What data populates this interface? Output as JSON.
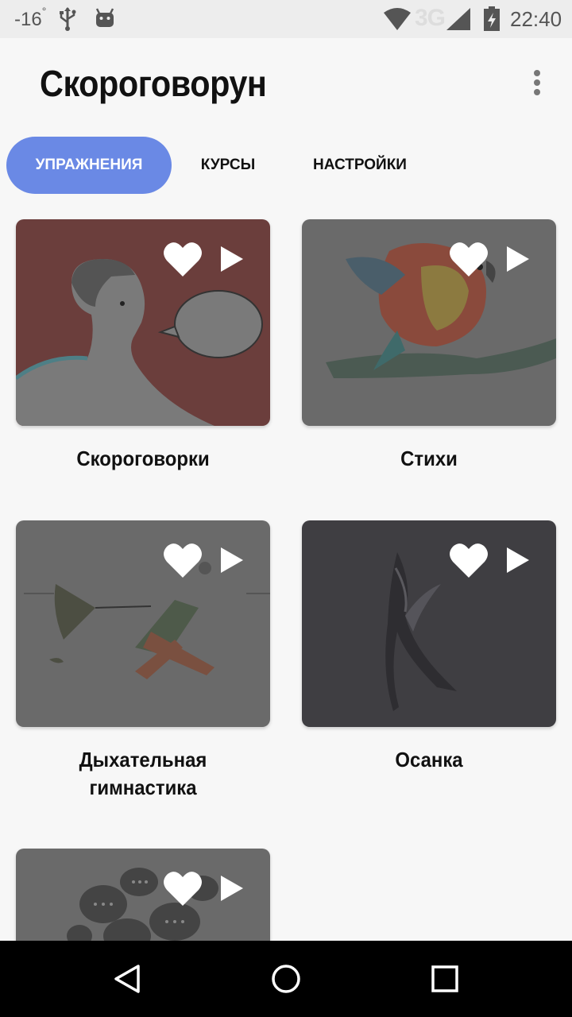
{
  "status_bar": {
    "temperature": "-16",
    "temperature_unit": "°",
    "network": "3G",
    "time": "22:40"
  },
  "app": {
    "title": "Скороговорун"
  },
  "tabs": [
    {
      "label": "УПРАЖНЕНИЯ",
      "active": true
    },
    {
      "label": "КУРСЫ",
      "active": false
    },
    {
      "label": "НАСТРОЙКИ",
      "active": false
    }
  ],
  "colors": {
    "accent": "#6a89e5",
    "card_1": "#6b3e3c",
    "card_2": "#6a6a6a",
    "card_3": "#6a6a6a",
    "card_4": "#3f3e42",
    "card_5": "#6a6a6a"
  },
  "cards": [
    {
      "label": "Скороговорки",
      "icon": "speaking-profile-illustration"
    },
    {
      "label": "Стихи",
      "icon": "parrot-illustration"
    },
    {
      "label_line1": "Дыхательная",
      "label_line2": "гимнастика",
      "icon": "umbrella-wind-illustration"
    },
    {
      "label": "Осанка",
      "icon": "dancer-illustration"
    },
    {
      "label": "",
      "icon": "speech-bubbles-illustration"
    }
  ],
  "card_actions": {
    "favorite_icon": "heart-icon",
    "play_icon": "play-icon"
  },
  "nav": {
    "back_icon": "back-icon",
    "home_icon": "home-icon",
    "recents_icon": "recents-icon"
  }
}
